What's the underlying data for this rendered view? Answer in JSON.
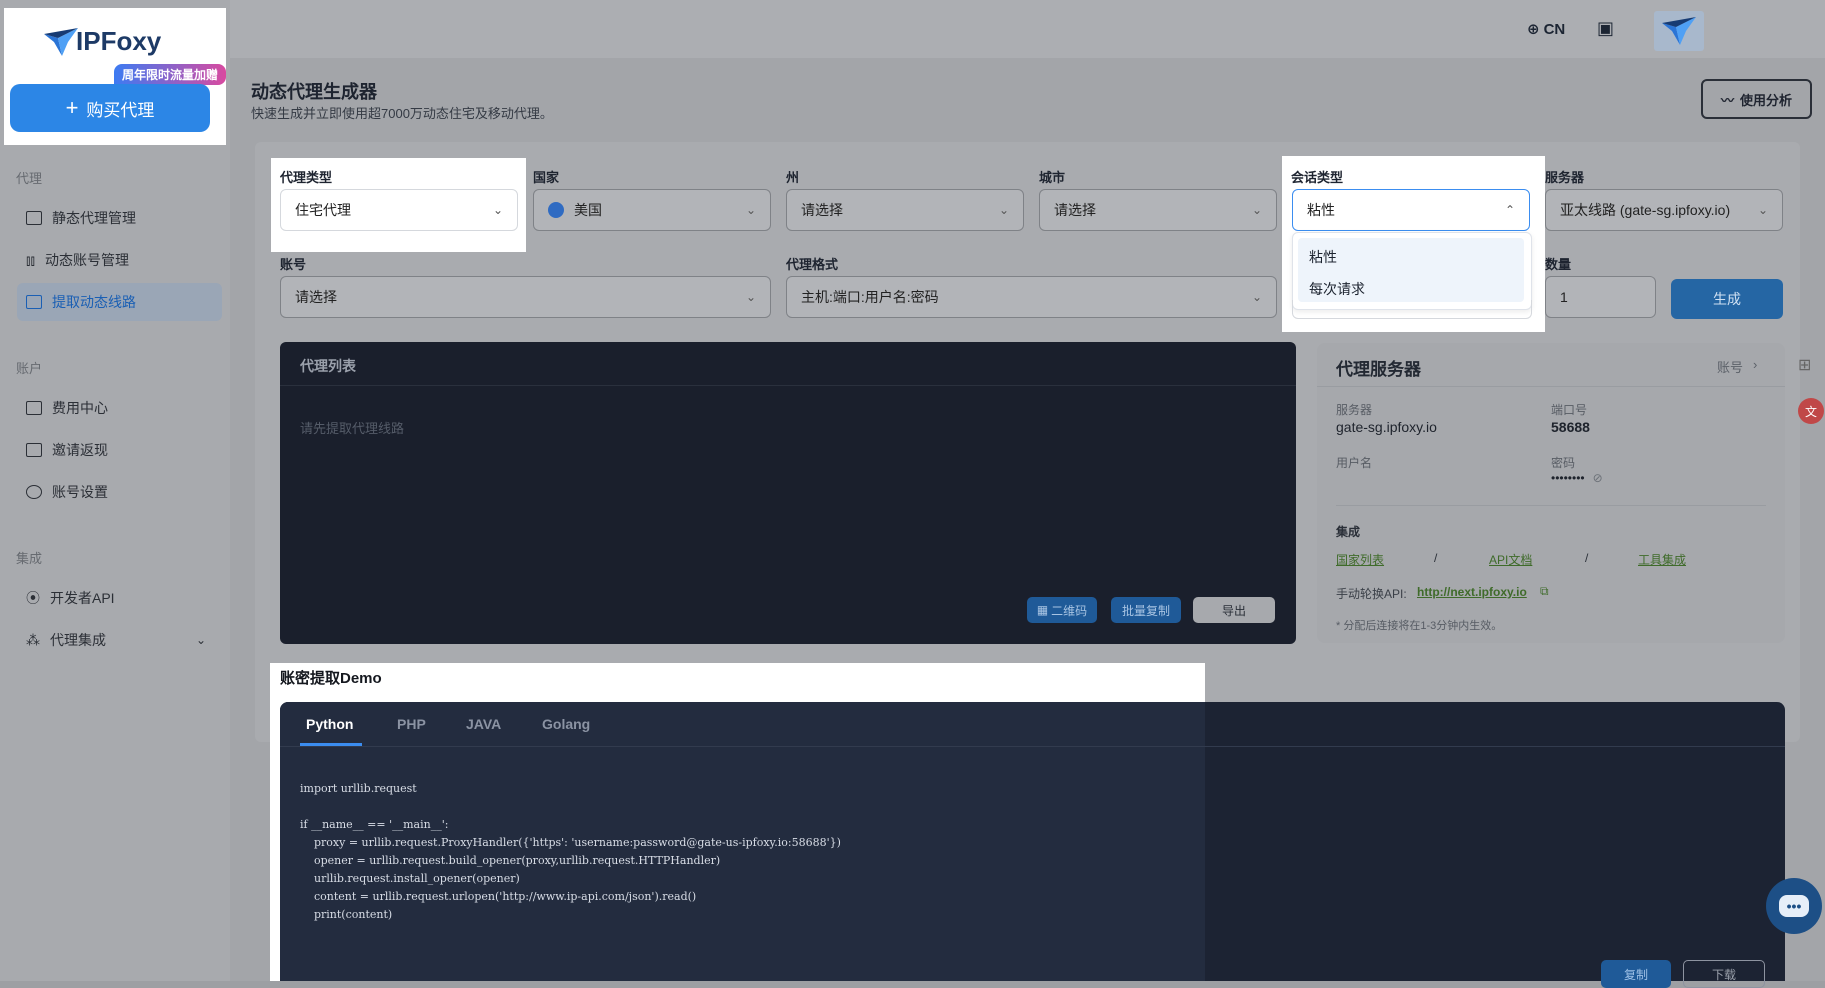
{
  "sidebar": {
    "logo": "IPFoxy",
    "promo": "周年限时流量加赠",
    "buy_button": "购买代理",
    "sections": [
      {
        "title": "代理",
        "items": [
          "静态代理管理",
          "动态账号管理",
          "提取动态线路"
        ]
      },
      {
        "title": "账户",
        "items": [
          "费用中心",
          "邀请返现",
          "账号设置"
        ]
      },
      {
        "title": "集成",
        "items": [
          "开发者API",
          "代理集成"
        ]
      }
    ]
  },
  "topbar": {
    "language": "CN"
  },
  "header": {
    "title": "动态代理生成器",
    "subtitle": "快速生成并立即使用超7000万动态住宅及移动代理。",
    "usage_button": "使用分析"
  },
  "form": {
    "proxy_type": {
      "label": "代理类型",
      "value": "住宅代理"
    },
    "country": {
      "label": "国家",
      "value": "美国"
    },
    "state": {
      "label": "州",
      "value": "请选择"
    },
    "city": {
      "label": "城市",
      "value": "请选择"
    },
    "session_type": {
      "label": "会话类型",
      "value": "粘性",
      "options": [
        "粘性",
        "每次请求"
      ]
    },
    "server": {
      "label": "服务器",
      "value": "亚太线路 (gate-sg.ipfoxy.io)"
    },
    "account": {
      "label": "账号",
      "value": "请选择"
    },
    "format": {
      "label": "代理格式",
      "value": "主机:端口:用户名:密码"
    },
    "quantity": {
      "label": "数量",
      "value": "1"
    },
    "generate_button": "生成"
  },
  "proxy_list": {
    "title": "代理列表",
    "empty": "请先提取代理线路",
    "qr_button": "二维码",
    "copy_button": "批量复制",
    "export_button": "导出"
  },
  "server_card": {
    "title": "代理服务器",
    "account_link": "账号",
    "server_label": "服务器",
    "server_value": "gate-sg.ipfoxy.io",
    "port_label": "端口号",
    "port_value": "58688",
    "username_label": "用户名",
    "password_label": "密码",
    "password_value": "••••••••",
    "integration_label": "集成",
    "links": [
      "国家列表",
      "API文档",
      "工具集成"
    ],
    "separator": "/",
    "api_label": "手动轮换API:",
    "api_link": "http://next.ipfoxy.io",
    "note": "* 分配后连接将在1-3分钟内生效。"
  },
  "demo": {
    "title": "账密提取Demo",
    "tabs": [
      "Python",
      "PHP",
      "JAVA",
      "Golang"
    ],
    "code": "import urllib.request\n\nif __name__ == '__main__':\n    proxy = urllib.request.ProxyHandler({'https': 'username:password@gate-us-ipfoxy.io:58688'})\n    opener = urllib.request.build_opener(proxy,urllib.request.HTTPHandler)\n    urllib.request.install_opener(opener)\n    content = urllib.request.urlopen('http://www.ip-api.com/json').read()\n    print(content)",
    "copy_button": "复制",
    "download_button": "下载"
  },
  "colors": {
    "accent": "#2c86e6",
    "highlight": "#ffffff",
    "dim": "#a3a5a9"
  }
}
